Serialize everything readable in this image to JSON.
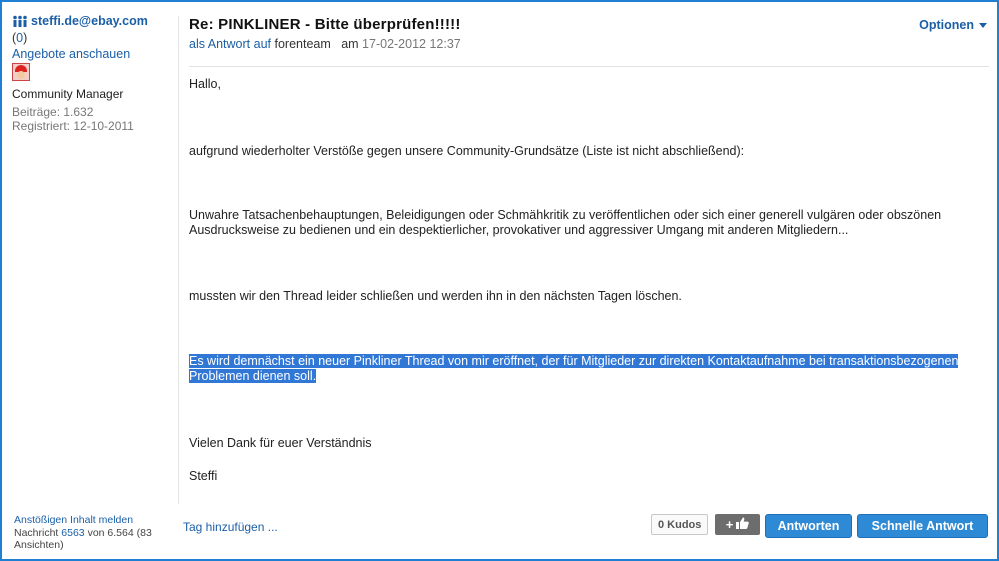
{
  "sidebar": {
    "author": "steffi.de@ebay.com",
    "kudos_open": "(",
    "kudos_value": "0",
    "kudos_close": ")",
    "offers_link": "Angebote anschauen",
    "rank": "Community Manager",
    "posts": "Beiträge: 1.632",
    "registered": "Registriert: 12-10-2011"
  },
  "post": {
    "subject": "Re: PINKLINER - Bitte überprüfen!!!!!",
    "reply_prefix": "als Antwort auf",
    "reply_user": "forenteam",
    "date_prefix": "am",
    "date": "17-02-2012 12:37",
    "options_label": "Optionen",
    "paragraphs": [
      "Hallo,",
      "aufgrund wiederholter Verstöße gegen unsere Community-Grundsätze (Liste ist nicht abschließend):",
      "Unwahre Tatsachenbehauptungen, Beleidigungen oder Schmähkritik zu veröffentlichen oder sich einer generell vulgären oder obszönen Ausdrucksweise zu bedienen und ein despektierlicher, provokativer und aggressiver Umgang mit anderen Mitgliedern...",
      "mussten wir den Thread leider schließen und werden ihn in den nächsten Tagen löschen.",
      "Es wird demnächst ein neuer Pinkliner Thread von mir eröffnet, der für Mitglieder zur direkten Kontaktaufnahme bei transaktionsbezogenen Problemen dienen soll.",
      "Vielen Dank für euer Verständnis",
      "Steffi"
    ]
  },
  "footer": {
    "report_link": "Anstößigen Inhalt melden",
    "message_prefix": "Nachricht",
    "message_number": "6563",
    "message_suffix": "von 6.564 (83 Ansichten)",
    "tag_link": "Tag hinzufügen ...",
    "kudos_label": "0 Kudos",
    "plus_label": "+",
    "reply_button": "Antworten",
    "quick_reply_button": "Schnelle Antwort"
  },
  "colors": {
    "accent": "#1f7fd3",
    "link": "#1b5fa6",
    "selection": "#3178d6",
    "button": "#2f8ad6"
  },
  "icons": [
    "users-icon",
    "avatar-image",
    "chevron-down-icon",
    "thumbs-up-icon"
  ]
}
